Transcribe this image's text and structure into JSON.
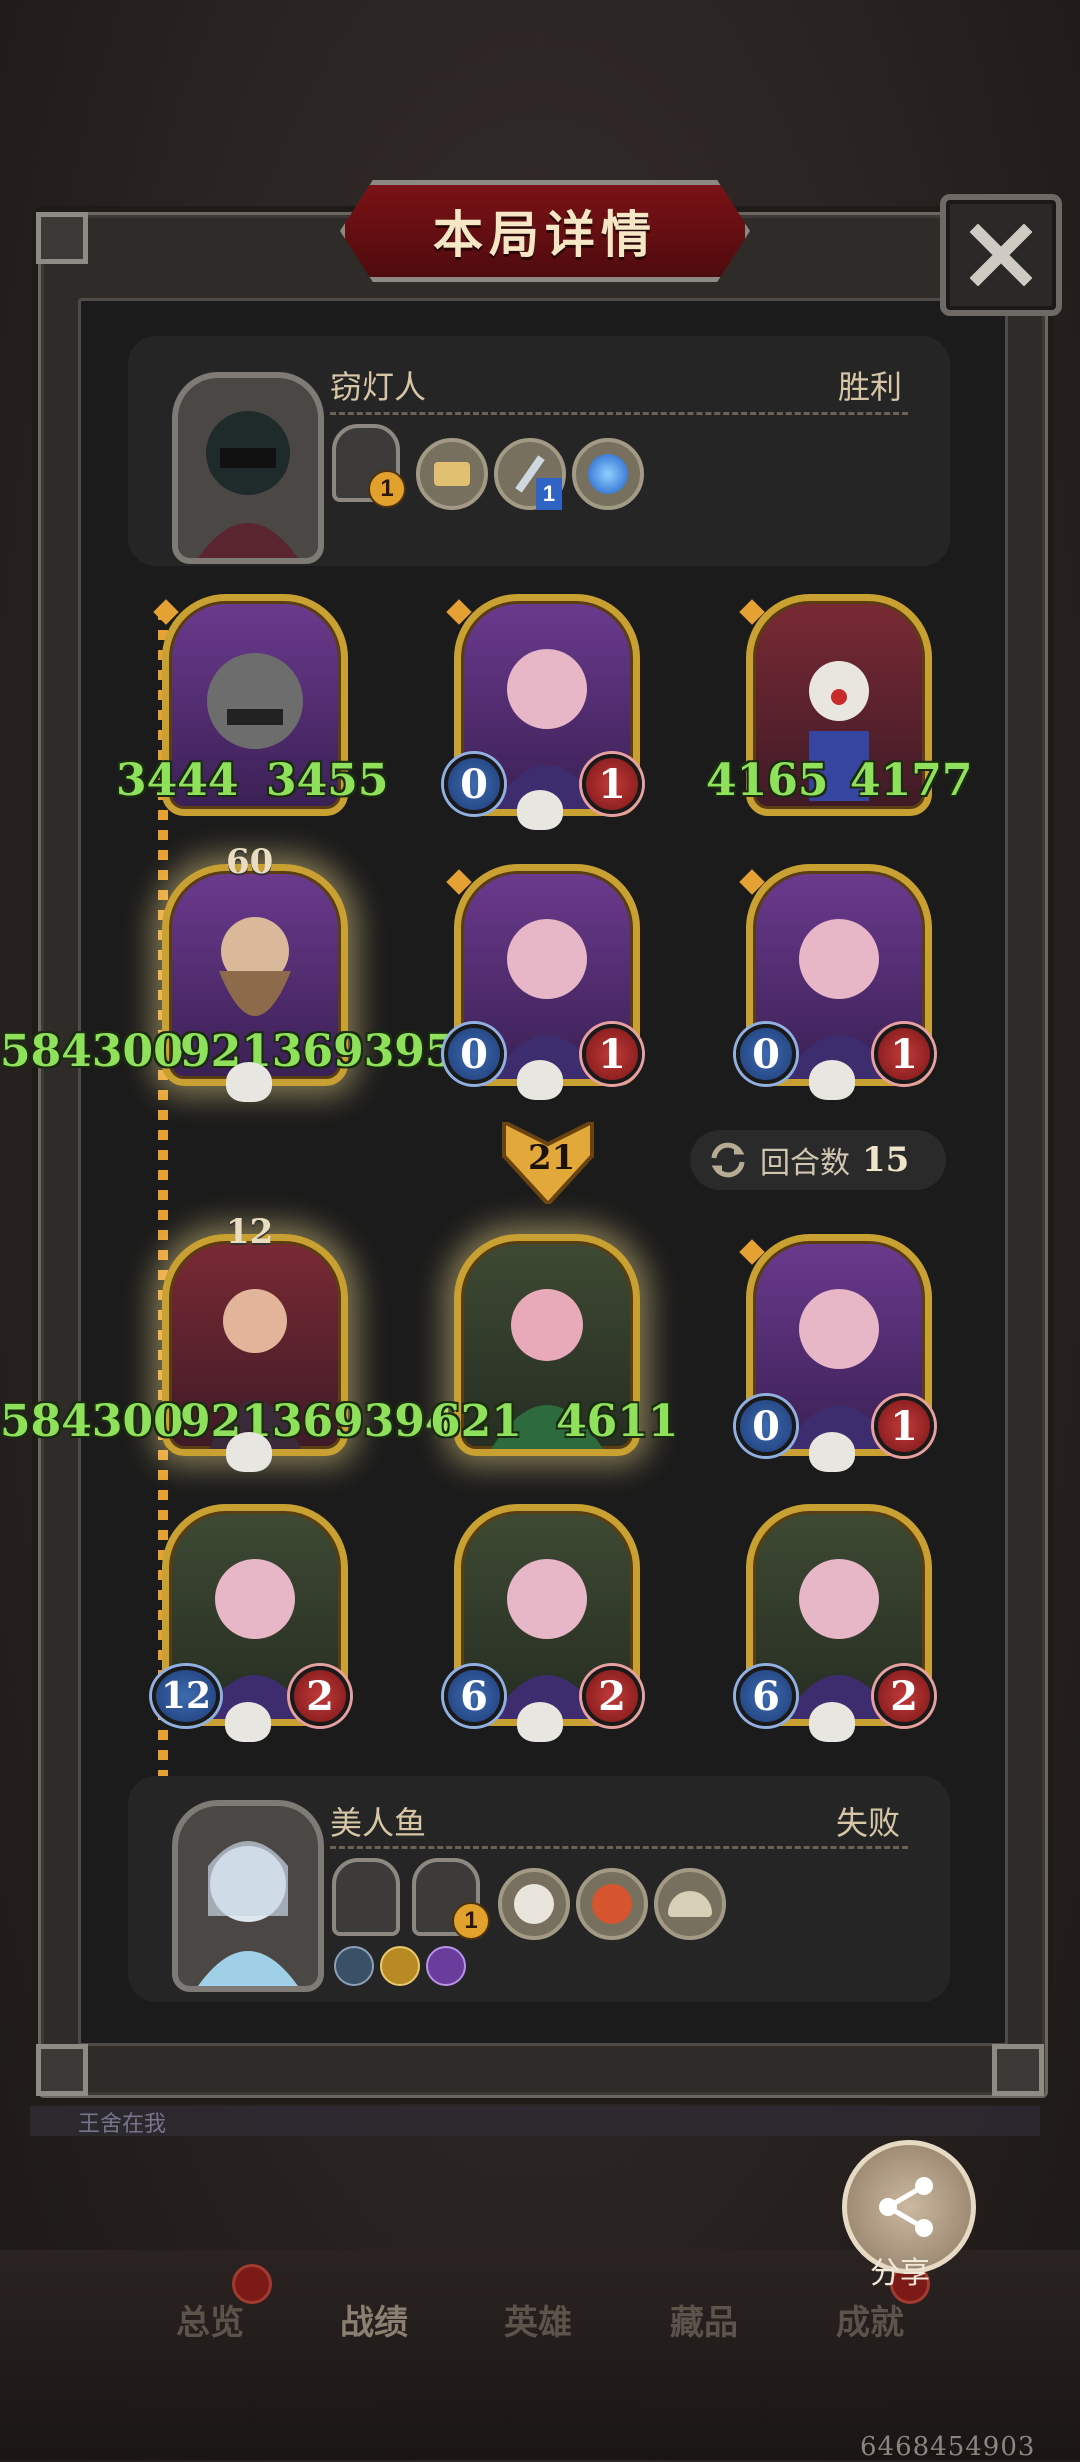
{
  "title": "本局详情",
  "top_player": {
    "name": "窃灯人",
    "result": "胜利",
    "badge_counts": [
      "1",
      "1"
    ]
  },
  "bottom_player": {
    "name": "美人鱼",
    "result": "失败",
    "badge_counts": [
      "1"
    ]
  },
  "board": {
    "row1": [
      {
        "attack": "3444",
        "health": "3455"
      },
      {
        "attack": "0",
        "health": "1"
      },
      {
        "attack": "4165",
        "health": "4177"
      }
    ],
    "row2": [
      {
        "level": "60",
        "attack": "584300",
        "health": "9213693955"
      },
      {
        "attack": "0",
        "health": "1"
      },
      {
        "attack": "0",
        "health": "1"
      }
    ],
    "row3": [
      {
        "level": "12",
        "attack": "584300",
        "health": "9213693944"
      },
      {
        "attack": "621",
        "health": "4611"
      },
      {
        "attack": "0",
        "health": "1"
      }
    ],
    "row4": [
      {
        "attack": "12",
        "health": "2"
      },
      {
        "attack": "6",
        "health": "2"
      },
      {
        "attack": "6",
        "health": "2"
      }
    ]
  },
  "arrow_count": "21",
  "rounds": {
    "label": "回合数",
    "value": "15"
  },
  "chat_text": "王舍在我",
  "share_label": "分享",
  "nav": [
    "总览",
    "战绩",
    "英雄",
    "藏品",
    "成就"
  ],
  "footer_id": "6468454903",
  "colors": {
    "banner_red": "#7b1216",
    "number_green": "#8fe05a",
    "card_gold": "#c9a032"
  }
}
